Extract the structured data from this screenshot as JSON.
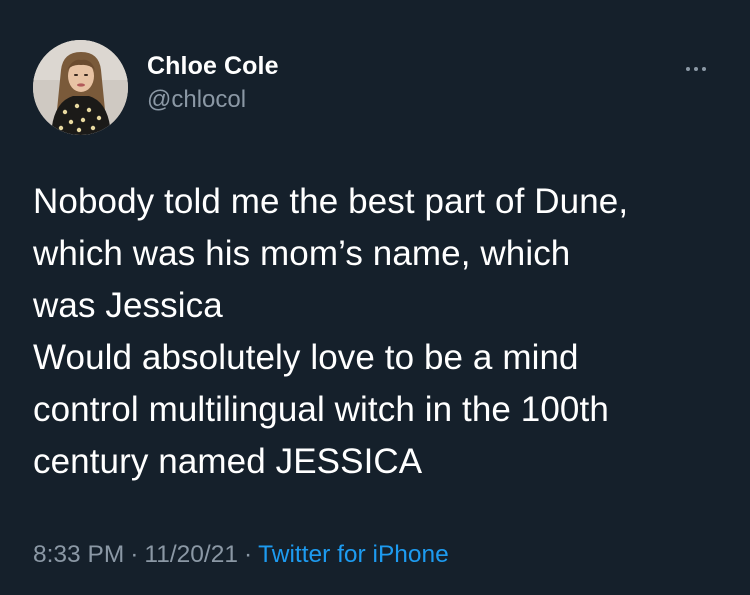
{
  "author": {
    "display_name": "Chloe Cole",
    "handle": "@chlocol"
  },
  "tweet": {
    "text": "Nobody told me the best part of Dune,\nwhich was his mom’s name, which\nwas Jessica\nWould absolutely love to be a mind\ncontrol multilingual witch in the 100th\ncentury named JESSICA"
  },
  "meta": {
    "time": "8:33 PM",
    "separator": "·",
    "date": "11/20/21",
    "source": "Twitter for iPhone"
  },
  "icons": {
    "more": "more-horizontal-icon",
    "avatar": "profile-photo"
  },
  "colors": {
    "background": "#15202b",
    "secondary_text": "#8b98a5",
    "link": "#1d9bf0"
  }
}
